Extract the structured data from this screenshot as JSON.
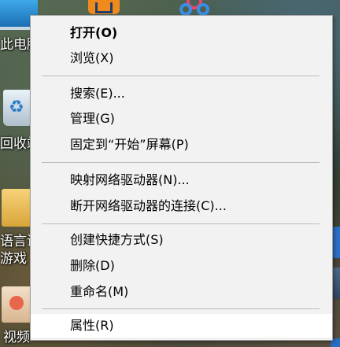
{
  "desktop": {
    "icons": [
      {
        "label": "此电脑"
      },
      {
        "label": "回收站"
      },
      {
        "label": "语言课"
      },
      {
        "label": "游戏"
      },
      {
        "label": "视频"
      }
    ]
  },
  "context_menu": {
    "items": [
      {
        "label": "打开(O)",
        "bold": true
      },
      {
        "label": "浏览(X)"
      },
      {
        "label": "搜索(E)..."
      },
      {
        "label": "管理(G)"
      },
      {
        "label": "固定到“开始”屏幕(P)"
      },
      {
        "label": "映射网络驱动器(N)..."
      },
      {
        "label": "断开网络驱动器的连接(C)..."
      },
      {
        "label": "创建快捷方式(S)"
      },
      {
        "label": "删除(D)"
      },
      {
        "label": "重命名(M)"
      },
      {
        "label": "属性(R)",
        "highlighted": true
      }
    ]
  }
}
